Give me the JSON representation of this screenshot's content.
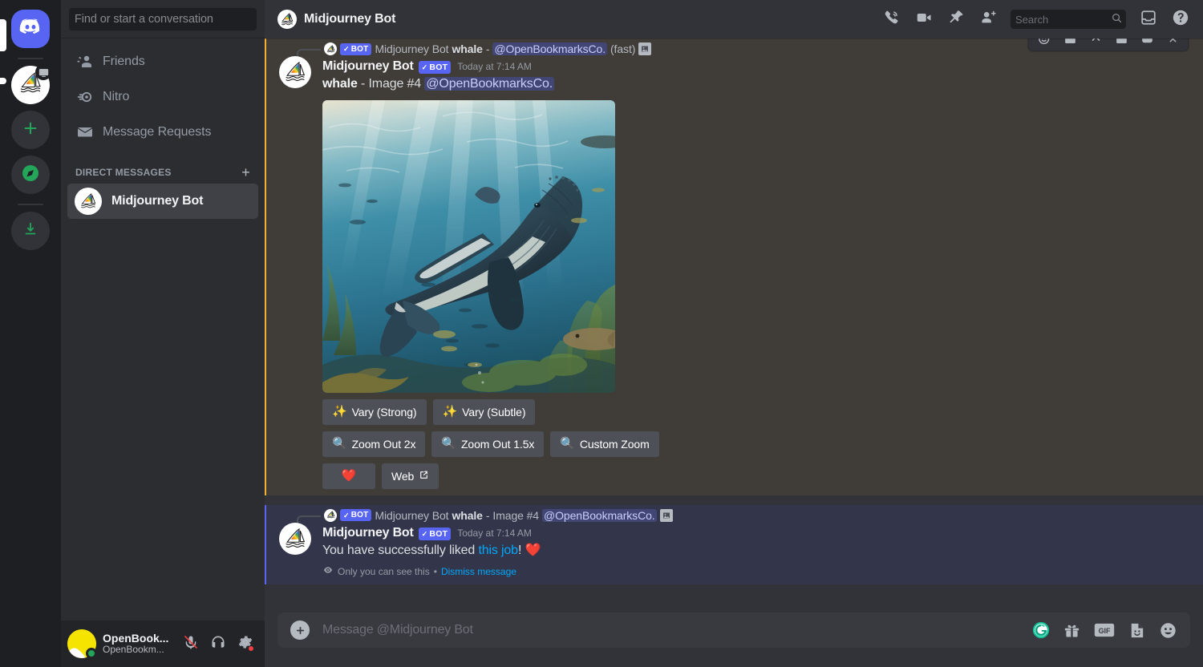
{
  "colors": {
    "brand": "#5865f2",
    "mention_bg": "#403c38",
    "mention_border": "#f0b132",
    "ephemeral_bg": "#33364a",
    "ephemeral_border": "#5865f2",
    "link": "#00a8fc",
    "online": "#23a55a",
    "button_bg": "#4e5058"
  },
  "rail": {
    "items": [
      {
        "name": "home",
        "icon": "discord-logo-icon",
        "label": "Discord"
      },
      {
        "name": "midjourney-server",
        "icon": "midjourney-sail-icon",
        "label": "Midjourney"
      },
      {
        "name": "add-server",
        "icon": "plus-icon",
        "label": "Add a Server"
      },
      {
        "name": "explore",
        "icon": "compass-icon",
        "label": "Explore Discoverable Servers"
      },
      {
        "name": "download-apps",
        "icon": "download-icon",
        "label": "Download Apps"
      }
    ]
  },
  "sidebar": {
    "search": {
      "placeholder": "Find or start a conversation"
    },
    "items": [
      {
        "label": "Friends",
        "icon": "friends-icon"
      },
      {
        "label": "Nitro",
        "icon": "nitro-icon"
      },
      {
        "label": "Message Requests",
        "icon": "envelope-icon"
      }
    ],
    "dm_header": {
      "label": "DIRECT MESSAGES",
      "add_icon": "plus-icon"
    },
    "dms": [
      {
        "label": "Midjourney Bot",
        "avatar": "midjourney-sail-icon",
        "active": true
      }
    ]
  },
  "user_panel": {
    "username": "OpenBook...",
    "handle": "OpenBookm...",
    "status": "online",
    "buttons": [
      {
        "name": "mute-button",
        "icon": "microphone-muted-icon"
      },
      {
        "name": "deafen-button",
        "icon": "headphones-icon"
      },
      {
        "name": "user-settings-button",
        "icon": "gear-icon"
      }
    ]
  },
  "topbar": {
    "title": "Midjourney Bot",
    "avatar": "midjourney-sail-icon",
    "icons": [
      {
        "name": "start-voice-call-button",
        "icon": "phone-call-icon"
      },
      {
        "name": "start-video-call-button",
        "icon": "video-camera-icon"
      },
      {
        "name": "pinned-messages-button",
        "icon": "pin-icon"
      },
      {
        "name": "add-friends-button",
        "icon": "add-person-icon"
      }
    ],
    "search": {
      "placeholder": "Search",
      "icon": "search-icon"
    },
    "right_icons": [
      {
        "name": "inbox-button",
        "icon": "inbox-icon"
      },
      {
        "name": "help-button",
        "icon": "question-mark-icon"
      }
    ]
  },
  "hover_toolbar": {
    "actions": [
      {
        "name": "add-reaction-button",
        "icon": "emoji-plus-icon"
      },
      {
        "name": "quick-reaction-button",
        "icon": "smile-icon"
      },
      {
        "name": "thread-button",
        "icon": "thread-icon"
      },
      {
        "name": "reaction-heart-button",
        "icon": "heart-icon"
      },
      {
        "name": "reply-button",
        "icon": "reply-icon"
      },
      {
        "name": "more-actions-button",
        "icon": "more-dots-icon"
      }
    ]
  },
  "messages": [
    {
      "kind": "mention",
      "reply": {
        "avatar": "midjourney-sail-icon",
        "bot_tag": "BOT",
        "bot_check": "✓",
        "author": "Midjourney Bot",
        "bold_text": "whale",
        "separator": "-",
        "mention": "@OpenBookmarksCo.",
        "suffix": "(fast)",
        "attachment_icon": "image-attachment-icon"
      },
      "author": "Midjourney Bot",
      "bot_tag": "BOT",
      "bot_check": "✓",
      "timestamp": "Today at 7:14 AM",
      "content": {
        "bold": "whale",
        "separator": "-",
        "plain": "Image #4",
        "mention": "@OpenBookmarksCo."
      },
      "image": {
        "alt": "humpback whale swimming underwater with sunbeams, fish and kelp"
      },
      "button_rows": [
        [
          {
            "label": "Vary (Strong)",
            "emoji": "✨",
            "name": "vary-strong-button"
          },
          {
            "label": "Vary (Subtle)",
            "emoji": "✨",
            "name": "vary-subtle-button"
          }
        ],
        [
          {
            "label": "Zoom Out 2x",
            "emoji": "🔍",
            "name": "zoom-out-2x-button"
          },
          {
            "label": "Zoom Out 1.5x",
            "emoji": "🔍",
            "name": "zoom-out-1-5x-button"
          },
          {
            "label": "Custom Zoom",
            "emoji": "🔍",
            "name": "custom-zoom-button"
          }
        ],
        [
          {
            "label": "",
            "emoji": "❤️",
            "name": "like-button"
          },
          {
            "label": "Web",
            "emoji": "",
            "name": "web-button",
            "external": true
          }
        ]
      ]
    },
    {
      "kind": "ephemeral",
      "reply": {
        "avatar": "midjourney-sail-icon",
        "bot_tag": "BOT",
        "bot_check": "✓",
        "author": "Midjourney Bot",
        "bold_text": "whale",
        "separator": "-",
        "plain": "Image #4",
        "mention": "@OpenBookmarksCo.",
        "attachment_icon": "image-attachment-icon"
      },
      "author": "Midjourney Bot",
      "bot_tag": "BOT",
      "bot_check": "✓",
      "timestamp": "Today at 7:14 AM",
      "content": {
        "prefix": "You have successfully liked ",
        "link": "this job",
        "suffix": "!",
        "emoji": "❤️"
      },
      "footer": {
        "eye_icon": "eye-icon",
        "text": "Only you can see this",
        "separator": "•",
        "dismiss": "Dismiss message"
      }
    }
  ],
  "composer": {
    "placeholder": "Message @Midjourney Bot",
    "plus_icon": "plus-icon",
    "icons": [
      {
        "name": "grammarly-button",
        "icon": "grammarly-icon",
        "label": "G"
      },
      {
        "name": "gift-button",
        "icon": "gift-icon"
      },
      {
        "name": "gif-picker-button",
        "icon": "gif-icon",
        "label": "GIF"
      },
      {
        "name": "sticker-picker-button",
        "icon": "sticker-icon"
      },
      {
        "name": "emoji-picker-button",
        "icon": "emoji-icon"
      }
    ]
  }
}
